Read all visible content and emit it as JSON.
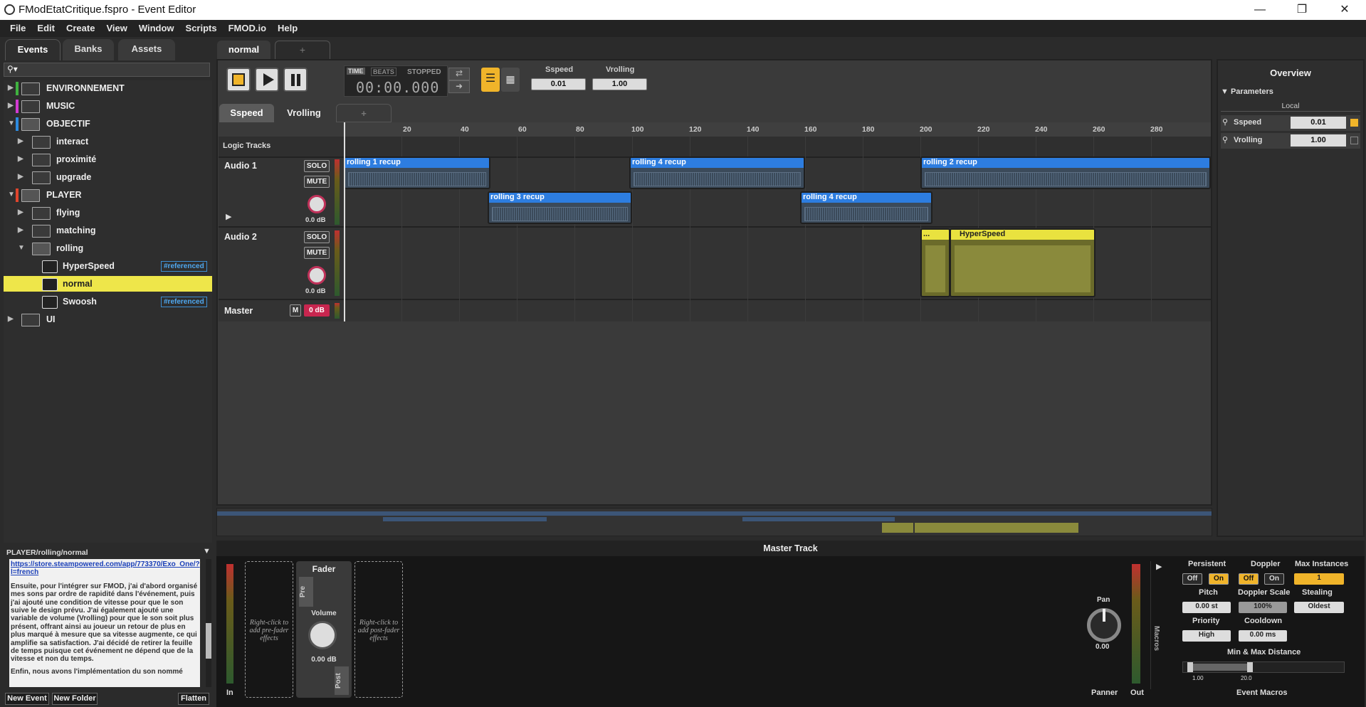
{
  "window": {
    "title": "FModEtatCritique.fspro - Event Editor",
    "minimize": "—",
    "maximize": "❐",
    "close": "✕"
  },
  "menu": [
    "File",
    "Edit",
    "Create",
    "View",
    "Window",
    "Scripts",
    "FMOD.io",
    "Help"
  ],
  "browser": {
    "tabs": [
      "Events",
      "Banks",
      "Assets"
    ],
    "search_placeholder": "",
    "tree": [
      {
        "label": "ENVIRONNEMENT",
        "type": "folder",
        "depth": 0,
        "expanded": false,
        "color": "#3fb23f"
      },
      {
        "label": "MUSIC",
        "type": "folder",
        "depth": 0,
        "expanded": false,
        "color": "#d23ad2"
      },
      {
        "label": "OBJECTIF",
        "type": "folder",
        "depth": 0,
        "expanded": true,
        "color": "#2d8be0"
      },
      {
        "label": "interact",
        "type": "folder",
        "depth": 1,
        "expanded": false
      },
      {
        "label": "proximité",
        "type": "folder",
        "depth": 1,
        "expanded": false
      },
      {
        "label": "upgrade",
        "type": "folder",
        "depth": 1,
        "expanded": false
      },
      {
        "label": "PLAYER",
        "type": "folder",
        "depth": 0,
        "expanded": true,
        "color": "#e0452d"
      },
      {
        "label": "flying",
        "type": "folder",
        "depth": 1,
        "expanded": false
      },
      {
        "label": "matching",
        "type": "folder",
        "depth": 1,
        "expanded": false
      },
      {
        "label": "rolling",
        "type": "folder",
        "depth": 1,
        "expanded": true
      },
      {
        "label": "HyperSpeed",
        "type": "event",
        "depth": 2,
        "badge": "#referenced"
      },
      {
        "label": "normal",
        "type": "event",
        "depth": 2,
        "selected": true
      },
      {
        "label": "Swoosh",
        "type": "event",
        "depth": 2,
        "badge": "#referenced"
      },
      {
        "label": "UI",
        "type": "folder",
        "depth": 0,
        "expanded": false
      }
    ],
    "path": "PLAYER/rolling/normal",
    "notes": {
      "link": "https://store.steampowered.com/app/773370/Exo_One/?l=french",
      "para1": "Ensuite, pour l'intégrer sur FMOD, j'ai d'abord organisé mes sons par ordre de rapidité dans l'événement, puis j'ai ajouté une condition de vitesse pour que le son suive le design prévu. J'ai également ajouté une variable de volume (Vrolling) pour que le son soit plus présent, offrant ainsi au joueur un retour de plus en plus marqué à mesure que sa vitesse augmente, ce qui amplifie sa satisfaction. J'ai décidé de retirer la feuille de temps puisque cet événement ne dépend que de la vitesse et non du temps.",
      "para2": "Enfin, nous avons l'implémentation du son nommé"
    },
    "buttons": [
      "New Event",
      "New Folder",
      "Flatten"
    ]
  },
  "editor": {
    "event_tab": "normal",
    "new_tab": "+",
    "transport": {
      "mode_time": "TIME",
      "mode_beats": "BEATS",
      "state": "STOPPED",
      "time": "00:00.000"
    },
    "params": [
      {
        "name": "Sspeed",
        "value": "0.01"
      },
      {
        "name": "Vrolling",
        "value": "1.00"
      }
    ],
    "param_tabs": [
      "Sspeed",
      "Vrolling",
      "+"
    ],
    "ruler_ticks": [
      "20",
      "40",
      "60",
      "80",
      "100",
      "120",
      "140",
      "160",
      "180",
      "200",
      "220",
      "240",
      "260",
      "280"
    ],
    "logic_tracks": "Logic Tracks",
    "tracks": [
      {
        "name": "Audio 1",
        "solo": "SOLO",
        "mute": "MUTE",
        "volume": "0.0 dB"
      },
      {
        "name": "Audio 2",
        "solo": "SOLO",
        "mute": "MUTE",
        "volume": "0.0 dB"
      }
    ],
    "master": {
      "name": "Master",
      "m": "M",
      "volume": "0 dB"
    },
    "regions": {
      "r1": "rolling 1 recup",
      "r4a": "rolling 4 recup",
      "r2": "rolling 2 recup",
      "r3": "rolling 3 recup",
      "r4b": "rolling 4 recup",
      "dots": "...",
      "hyper": "HyperSpeed"
    }
  },
  "overview_panel": {
    "title": "Overview",
    "section": "Parameters",
    "scope": "Local",
    "params": [
      {
        "name": "Sspeed",
        "value": "0.01"
      },
      {
        "name": "Vrolling",
        "value": "1.00"
      }
    ]
  },
  "master_track": {
    "title": "Master Track",
    "in": "In",
    "out": "Out",
    "pre_hint": "Right-click to add pre-fader effects",
    "post_hint": "Right-click to add post-fader effects",
    "fader": "Fader",
    "pre": "Pre",
    "post": "Post",
    "volume_label": "Volume",
    "volume": "0.00 dB",
    "pan_label": "Pan",
    "pan": "0.00",
    "panner": "Panner",
    "macros_vertical": "Macros",
    "event_macros": "Event Macros",
    "persistent": {
      "label": "Persistent",
      "off": "Off",
      "on": "On"
    },
    "doppler": {
      "label": "Doppler",
      "off": "Off",
      "on": "On"
    },
    "max_instances": {
      "label": "Max Instances",
      "value": "1"
    },
    "pitch": {
      "label": "Pitch",
      "value": "0.00 st"
    },
    "doppler_scale": {
      "label": "Doppler Scale",
      "value": "100%"
    },
    "stealing": {
      "label": "Stealing",
      "value": "Oldest"
    },
    "priority": {
      "label": "Priority",
      "value": "High"
    },
    "cooldown": {
      "label": "Cooldown",
      "value": "0.00 ms"
    },
    "distance": {
      "label": "Min & Max Distance",
      "min": "1.00",
      "max": "20.0",
      "ticks": [
        "0",
        "1.0",
        "5",
        "20.0",
        "100",
        "1k",
        "10k"
      ]
    }
  },
  "colors": {
    "accent_yellow": "#eee64a",
    "region_blue": "#2d7de0",
    "toggle_on": "#f0b42a"
  }
}
